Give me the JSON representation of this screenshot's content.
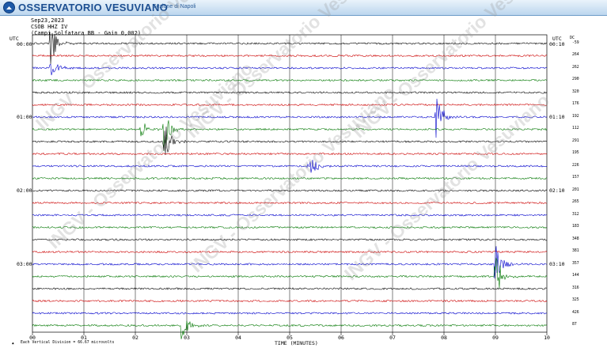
{
  "header": {
    "title": "OSSERVATORIO VESUVIANO",
    "subtitle": "Sezione di Napoli"
  },
  "meta": {
    "date": "Sep23,2023",
    "station": "CSOB HHZ IV",
    "description": "(Campi Solfatara BB - Gain 0,002)"
  },
  "tz": {
    "left": "UTC",
    "right": "UTC",
    "unit": "DC"
  },
  "time_labels_left": [
    "00:00",
    "01:00",
    "02:00",
    "03:00"
  ],
  "time_labels_right": [
    "00:10",
    "01:10",
    "02:10",
    "03:10"
  ],
  "amplitude_values": [
    "-59",
    "264",
    "262",
    "290",
    "320",
    "176",
    "192",
    "112",
    "291",
    "195",
    "226",
    "157",
    "201",
    "265",
    "312",
    "183",
    "348",
    "381",
    "357",
    "144",
    "316",
    "325",
    "426",
    "87"
  ],
  "x_ticks": [
    "00",
    "01",
    "02",
    "03",
    "04",
    "05",
    "06",
    "07",
    "08",
    "09",
    "10"
  ],
  "xlabel": "TIME (MINUTES)",
  "footer_note": "Each Vertical Division = 66.67 microvolts",
  "footer_mark": "▲",
  "watermark": [
    "INGV - Osservatorio Vesuviano"
  ],
  "trace_colors": [
    "#000000",
    "#cc0000",
    "#0000cc",
    "#007700"
  ],
  "events": [
    {
      "row": 0,
      "minute": 0.35,
      "amp": 1.0,
      "color": "#000000"
    },
    {
      "row": 2,
      "minute": 0.35,
      "amp": 0.6,
      "color": "#0000cc"
    },
    {
      "row": 7,
      "minute": 2.1,
      "amp": 0.5,
      "color": "#007700"
    },
    {
      "row": 7,
      "minute": 2.55,
      "amp": 1.0,
      "color": "#007700"
    },
    {
      "row": 8,
      "minute": 2.55,
      "amp": 1.0,
      "color": "#000000"
    },
    {
      "row": 10,
      "minute": 5.35,
      "amp": 0.8,
      "color": "#0000cc"
    },
    {
      "row": 6,
      "minute": 7.85,
      "amp": 1.0,
      "color": "#0000cc"
    },
    {
      "row": 18,
      "minute": 9.0,
      "amp": 1.0,
      "color": "#007700"
    },
    {
      "row": 19,
      "minute": 9.0,
      "amp": 1.0,
      "color": "#007700"
    },
    {
      "row": 23,
      "minute": 2.9,
      "amp": 0.9,
      "color": "#007700"
    }
  ]
}
